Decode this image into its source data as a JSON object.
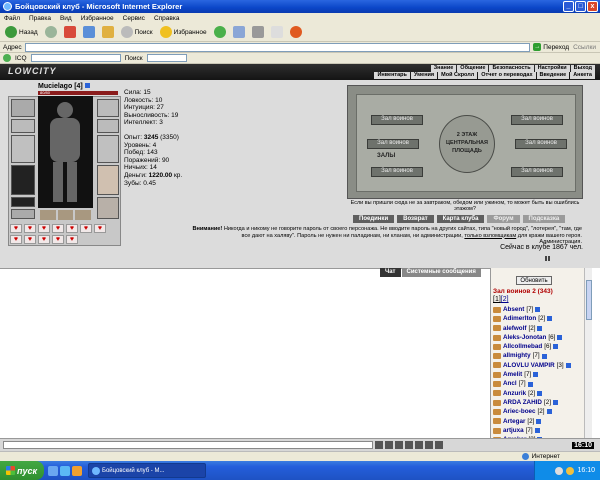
{
  "window": {
    "title": "Бойцовский клуб - Microsoft Internet Explorer",
    "min": "_",
    "max": "□",
    "close": "x"
  },
  "menu": [
    "Файл",
    "Правка",
    "Вид",
    "Избранное",
    "Сервис",
    "Справка"
  ],
  "toolbar": {
    "back": "Назад",
    "search": "Поиск",
    "favorites": "Избранное"
  },
  "address": {
    "label": "Адрес",
    "value": "",
    "go": "Переход",
    "links": "Ссылки"
  },
  "icqbar": {
    "icq": "ICQ",
    "search": "Поиск"
  },
  "game": {
    "logo": "LOWCITY",
    "nav_top": [
      "Знание",
      "Общение",
      "Безопасность",
      "Настройки",
      "Выход"
    ],
    "nav_bottom": [
      "Инвентарь",
      "Умения",
      "Мой Скролл",
      "Отчет о переводах",
      "Введение",
      "Анкета"
    ],
    "character": {
      "name": "Mucielago",
      "level": "[4]",
      "hp": "80/80"
    },
    "stats": {
      "strength": "Сила: 15",
      "agility": "Ловкость: 10",
      "intuition": "Интуиция: 27",
      "endurance": "Выносливость: 19",
      "intellect": "Интеллект: 3",
      "exp_label": "Опыт:",
      "exp_value": "3245",
      "exp_next": "(3350)",
      "level": "Уровень: 4",
      "wins": "Побед: 143",
      "losses": "Поражений: 90",
      "draws": "Ничьих: 14",
      "money_label": "Деньги:",
      "money_value": "1220.00",
      "money_unit": "кр.",
      "teeth_label": "Зубы:",
      "teeth_value": "0.45"
    },
    "map": {
      "floor": "2 ЭТАЖ",
      "hall_label": "ЗАЛЫ",
      "center": "ЦЕНТРАЛЬНАЯ ПЛОЩАДЬ",
      "rooms": [
        "Зал воинов",
        "Зал воинов",
        "Зал воинов",
        "Зал воинов",
        "Зал воинов",
        "Зал воинов"
      ],
      "tip": "Если вы пришли сюда не за завтраком, обедом или ужином, то может быть вы ошиблись этажом?"
    },
    "actions": [
      "Поединки",
      "Возврат",
      "Карта клуба",
      "Форум",
      "Подсказка"
    ],
    "warning": {
      "label": "Внимание!",
      "text": "Никогда и никому не говорите пароль от своего персонажа. Не вводите пароль на других сайтах, типа \"новый город\", \"лотерея\", \"там, где все дают на халяву\". Пароль не нужен ни паладинам, ни кланам, ни администрации,",
      "link": "только взломщикам",
      "tail": "для кражи вашего героя.",
      "sign": "Администрация."
    },
    "online": "Сейчас в клубе 1867 чел."
  },
  "chat": {
    "tabs": [
      "Чат",
      "Системные сообщения"
    ],
    "refresh": "Обновить",
    "room": "Зал воинов 2 (343)",
    "pages": [
      "[1]",
      "[2]"
    ],
    "users": [
      {
        "name": "Absent",
        "level": "[7]"
      },
      {
        "name": "Adimerlton",
        "level": "[2]"
      },
      {
        "name": "alefwolf",
        "level": "[2]"
      },
      {
        "name": "Aleks-Jonotan",
        "level": "[6]"
      },
      {
        "name": "Allcollmebad",
        "level": "[6]"
      },
      {
        "name": "allmighty",
        "level": "[7]"
      },
      {
        "name": "ALOVLU VAMPIR",
        "level": "[3]"
      },
      {
        "name": "Amelit",
        "level": "[7]"
      },
      {
        "name": "Ancl",
        "level": "[7]"
      },
      {
        "name": "Anzurik",
        "level": "[2]"
      },
      {
        "name": "ARDA ZAHID",
        "level": "[2]"
      },
      {
        "name": "Ariec-boec",
        "level": "[2]"
      },
      {
        "name": "Artegar",
        "level": "[2]"
      },
      {
        "name": "artjuxa",
        "level": "[7]"
      },
      {
        "name": "Arxaker",
        "level": "[3]"
      }
    ]
  },
  "clock": "16:10",
  "status": {
    "zone": "Интернет"
  },
  "taskbar": {
    "start": "пуск",
    "item": "Бойцовский клуб - M...",
    "time": "16:10"
  }
}
